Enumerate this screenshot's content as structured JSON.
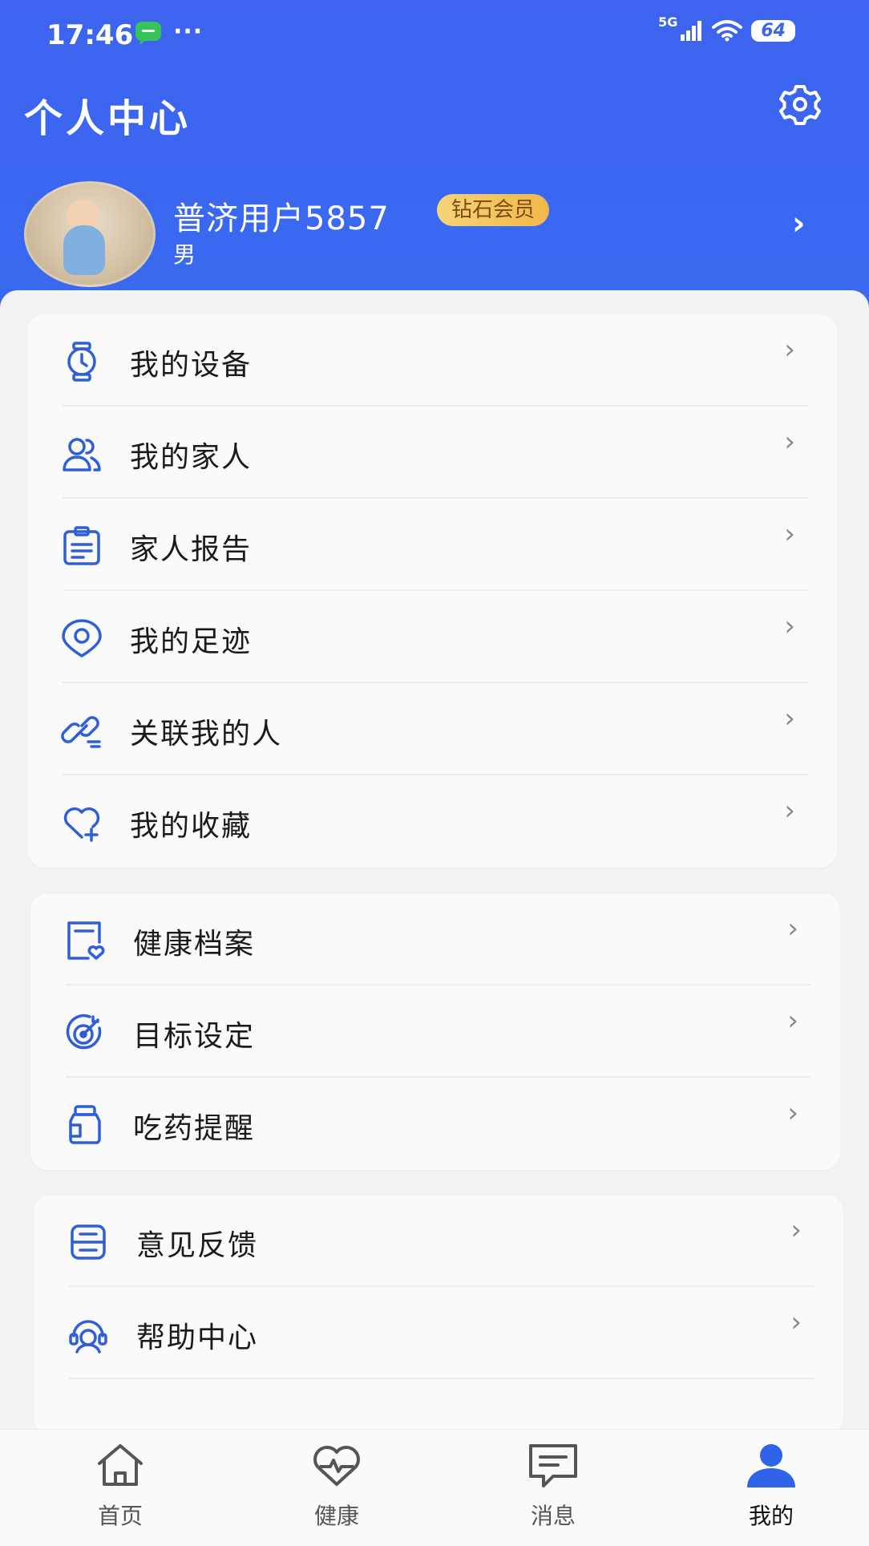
{
  "status_bar": {
    "time": "17:46",
    "dots": "···",
    "network": "5G",
    "battery": "64"
  },
  "header": {
    "title": "个人中心"
  },
  "profile": {
    "name": "普济用户5857",
    "badge": "钻石会员",
    "gender": "男"
  },
  "menu_groups": [
    {
      "items": [
        {
          "label": "我的设备",
          "icon": "watch-icon"
        },
        {
          "label": "我的家人",
          "icon": "family-icon"
        },
        {
          "label": "家人报告",
          "icon": "report-icon"
        },
        {
          "label": "我的足迹",
          "icon": "footprint-icon"
        },
        {
          "label": "关联我的人",
          "icon": "link-icon"
        },
        {
          "label": "我的收藏",
          "icon": "favorite-icon"
        }
      ]
    },
    {
      "items": [
        {
          "label": "健康档案",
          "icon": "health-record-icon"
        },
        {
          "label": "目标设定",
          "icon": "target-icon"
        },
        {
          "label": "吃药提醒",
          "icon": "medicine-icon"
        }
      ]
    },
    {
      "items": [
        {
          "label": "意见反馈",
          "icon": "feedback-icon"
        },
        {
          "label": "帮助中心",
          "icon": "help-icon"
        }
      ]
    }
  ],
  "tabbar": [
    {
      "label": "首页",
      "icon": "home-icon",
      "active": false
    },
    {
      "label": "健康",
      "icon": "heart-pulse-icon",
      "active": false
    },
    {
      "label": "消息",
      "icon": "message-icon",
      "active": false
    },
    {
      "label": "我的",
      "icon": "user-icon",
      "active": true
    }
  ],
  "colors": {
    "primary": "#3d63ef",
    "icon_blue": "#2f5fd8",
    "vip_gold": "#f0b84a"
  }
}
